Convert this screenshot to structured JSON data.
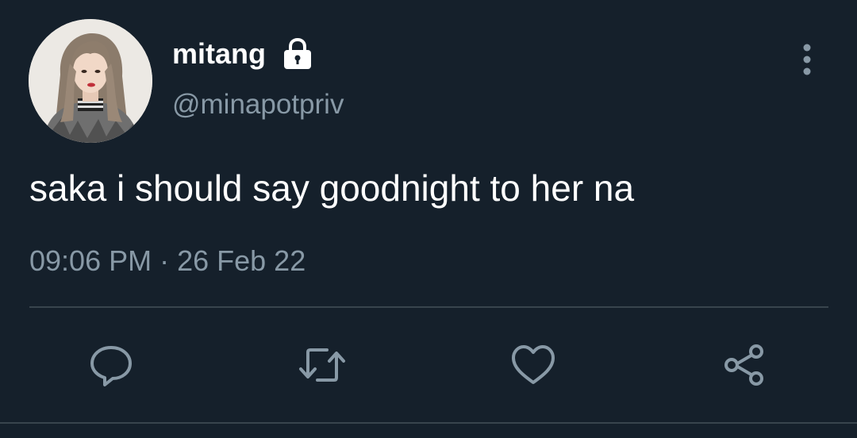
{
  "tweet": {
    "display_name": "mitang",
    "handle": "@minapotpriv",
    "text": "saka i should say goodnight to her na",
    "time": "09:06 PM",
    "separator": " · ",
    "date": "26 Feb 22"
  },
  "icons": {
    "lock": "lock-icon",
    "more": "more-vertical-icon",
    "reply": "reply-icon",
    "retweet": "retweet-icon",
    "like": "heart-icon",
    "share": "share-icon"
  },
  "colors": {
    "background": "#15202b",
    "text_primary": "#ffffff",
    "text_secondary": "#8899a6",
    "divider": "#38444d"
  }
}
